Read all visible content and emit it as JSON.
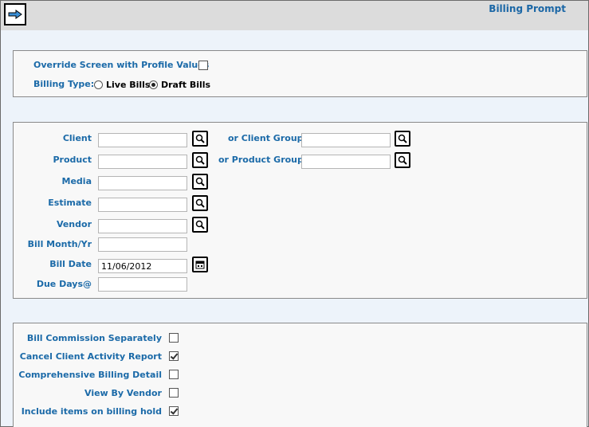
{
  "header": {
    "title": "Billing Prompt",
    "go_icon": "arrow-right-icon"
  },
  "options": {
    "override_label": "Override Screen with Profile Values",
    "override_checked": false,
    "billing_type_label": "Billing Type:",
    "live_bills_label": "Live Bills",
    "draft_bills_label": "Draft Bills",
    "billing_type_selected": "Draft Bills"
  },
  "filters": {
    "client_label": "Client",
    "client_value": "",
    "client_group_label": "or Client Group",
    "client_group_value": "",
    "product_label": "Product",
    "product_value": "",
    "product_group_label": "or Product Group",
    "product_group_value": "",
    "media_label": "Media",
    "media_value": "",
    "estimate_label": "Estimate",
    "estimate_value": "",
    "vendor_label": "Vendor",
    "vendor_value": "",
    "bill_month_label": "Bill Month/Yr",
    "bill_month_value": "",
    "bill_date_label": "Bill Date",
    "bill_date_value": "11/06/2012",
    "due_days_label": "Due Days@",
    "due_days_value": ""
  },
  "settings": {
    "bill_commission_label": "Bill Commission Separately",
    "bill_commission_checked": false,
    "cancel_activity_label": "Cancel Client Activity Report",
    "cancel_activity_checked": true,
    "comprehensive_label": "Comprehensive Billing Detail",
    "comprehensive_checked": false,
    "view_by_vendor_label": "View By Vendor",
    "view_by_vendor_checked": false,
    "include_hold_label": "Include items on billing hold",
    "include_hold_checked": true
  }
}
